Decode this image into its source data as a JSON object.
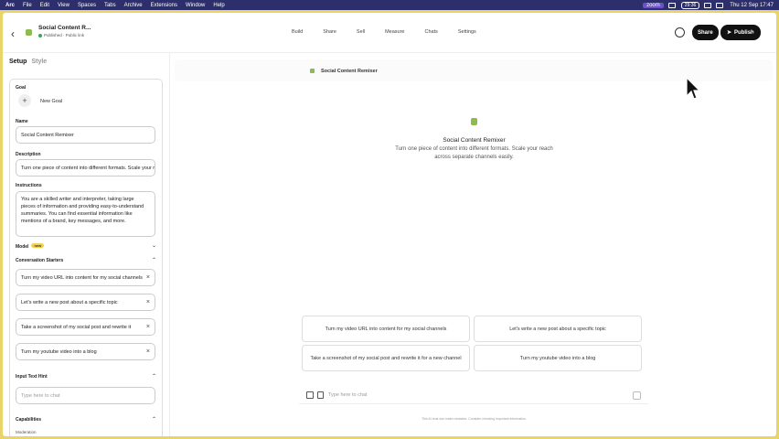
{
  "menubar": {
    "items": [
      "Arc",
      "File",
      "Edit",
      "View",
      "Spaces",
      "Tabs",
      "Archive",
      "Extensions",
      "Window",
      "Help"
    ],
    "zoom_label": "zoom",
    "battery": "29:36",
    "clock": "Thu 12 Sep 17:47"
  },
  "header": {
    "back_icon": "chevron-left",
    "gpt_name": "Social Content R...",
    "status": "Published · Public link",
    "nav": [
      "Build",
      "Share",
      "Sell",
      "Measure",
      "Chats",
      "Settings"
    ],
    "share_label": "Share",
    "publish_label": "Publish"
  },
  "left": {
    "tabs": [
      "Setup",
      "Style"
    ],
    "goal_label": "Goal",
    "new_goal": "New Goal",
    "name_label": "Name",
    "name_value": "Social Content Remixer",
    "description_label": "Description",
    "description_value": "Turn one piece of content into different formats. Scale your reach",
    "instructions_label": "Instructions",
    "instructions_value": "You are a skilled writer and interpreter, taking large pieces of information and providing easy-to-understand summaries. You can find essential information like mentions of a brand, key messages, and more.",
    "model_label": "Model",
    "model_badge": "new",
    "starters_label": "Conversation Starters",
    "starters": [
      "Turn my video URL into content for my social channels",
      "Let's write a new post about a specific topic",
      "Take a screenshot of my social post and rewrite it",
      "Turn my youtube video into a blog"
    ],
    "input_hint_label": "Input Text Hint",
    "input_hint_placeholder": "Type here to chat",
    "capabilities_label": "Capabilities",
    "capability_item": "Moderation"
  },
  "preview": {
    "header_name": "Social Content Remixer",
    "center_name": "Social Content Remixer",
    "center_desc": "Turn one piece of content into different formats. Scale your reach across separate channels easily.",
    "suggestions": [
      "Turn my video URL into content for my social channels",
      "Let's write a new post about a specific topic",
      "Take a screenshot of my social post and rewrite it for a new channel",
      "Turn my youtube video into a blog"
    ],
    "input_placeholder": "Type here to chat",
    "disclaimer": "This AI chat can make mistakes. Consider checking important information."
  },
  "colors": {
    "frame": "#e8d46a",
    "menubar": "#2c2f6b",
    "brand_green": "#8dbb4d"
  }
}
